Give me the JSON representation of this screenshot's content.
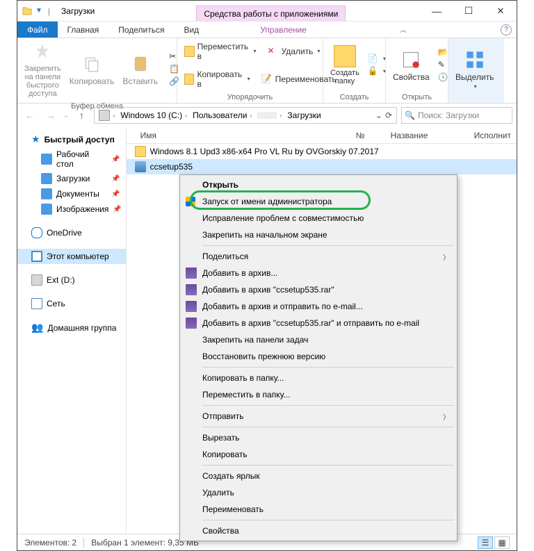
{
  "window": {
    "title": "Загрузки",
    "contextTab": "Средства работы с приложениями"
  },
  "tabs": {
    "file": "Файл",
    "home": "Главная",
    "share": "Поделиться",
    "view": "Вид",
    "manage": "Управление"
  },
  "ribbon": {
    "clipboard": {
      "label": "Буфер обмена",
      "pin": "Закрепить на панели\nбыстрого доступа",
      "copy": "Копировать",
      "paste": "Вставить"
    },
    "organize": {
      "label": "Упорядочить",
      "moveTo": "Переместить в",
      "copyTo": "Копировать в",
      "delete": "Удалить",
      "rename": "Переименовать"
    },
    "new": {
      "label": "Создать",
      "newFolder": "Создать\nпапку"
    },
    "open": {
      "label": "Открыть",
      "properties": "Свойства"
    },
    "select": {
      "label": "",
      "selectBtn": "Выделить"
    }
  },
  "path": {
    "crumbs": [
      "Windows 10 (C:)",
      "Пользователи",
      "",
      "Загрузки"
    ]
  },
  "search": {
    "placeholder": "Поиск: Загрузки"
  },
  "sidebar": {
    "quick": "Быстрый доступ",
    "desktop": "Рабочий стол",
    "downloads": "Загрузки",
    "documents": "Документы",
    "pictures": "Изображения",
    "onedrive": "OneDrive",
    "thispc": "Этот компьютер",
    "extd": "Ext (D:)",
    "network": "Сеть",
    "homegroup": "Домашняя группа"
  },
  "columns": {
    "name": "Имя",
    "num": "№",
    "title": "Название",
    "artists": "Исполнит"
  },
  "files": [
    {
      "name": "Windows 8.1 Upd3 x86-x64 Pro VL Ru by OVGorskiy 07.2017",
      "type": "folder"
    },
    {
      "name": "ccsetup535",
      "type": "exe"
    }
  ],
  "context": {
    "open": "Открыть",
    "runAsAdmin": "Запуск от имени администратора",
    "troubleshoot": "Исправление проблем с совместимостью",
    "pinStart": "Закрепить на начальном экране",
    "share": "Поделиться",
    "addArchive": "Добавить в архив...",
    "addRar": "Добавить в архив \"ccsetup535.rar\"",
    "addEmail": "Добавить в архив и отправить по e-mail...",
    "addRarEmail": "Добавить в архив \"ccsetup535.rar\" и отправить по e-mail",
    "pinTaskbar": "Закрепить на панели задач",
    "restore": "Восстановить прежнюю версию",
    "copyToFolder": "Копировать в папку...",
    "moveToFolder": "Переместить в папку...",
    "sendTo": "Отправить",
    "cut": "Вырезать",
    "copy": "Копировать",
    "shortcut": "Создать ярлык",
    "delete": "Удалить",
    "rename": "Переименовать",
    "properties": "Свойства"
  },
  "status": {
    "count": "Элементов: 2",
    "selected": "Выбран 1 элемент: 9,35 МБ"
  }
}
